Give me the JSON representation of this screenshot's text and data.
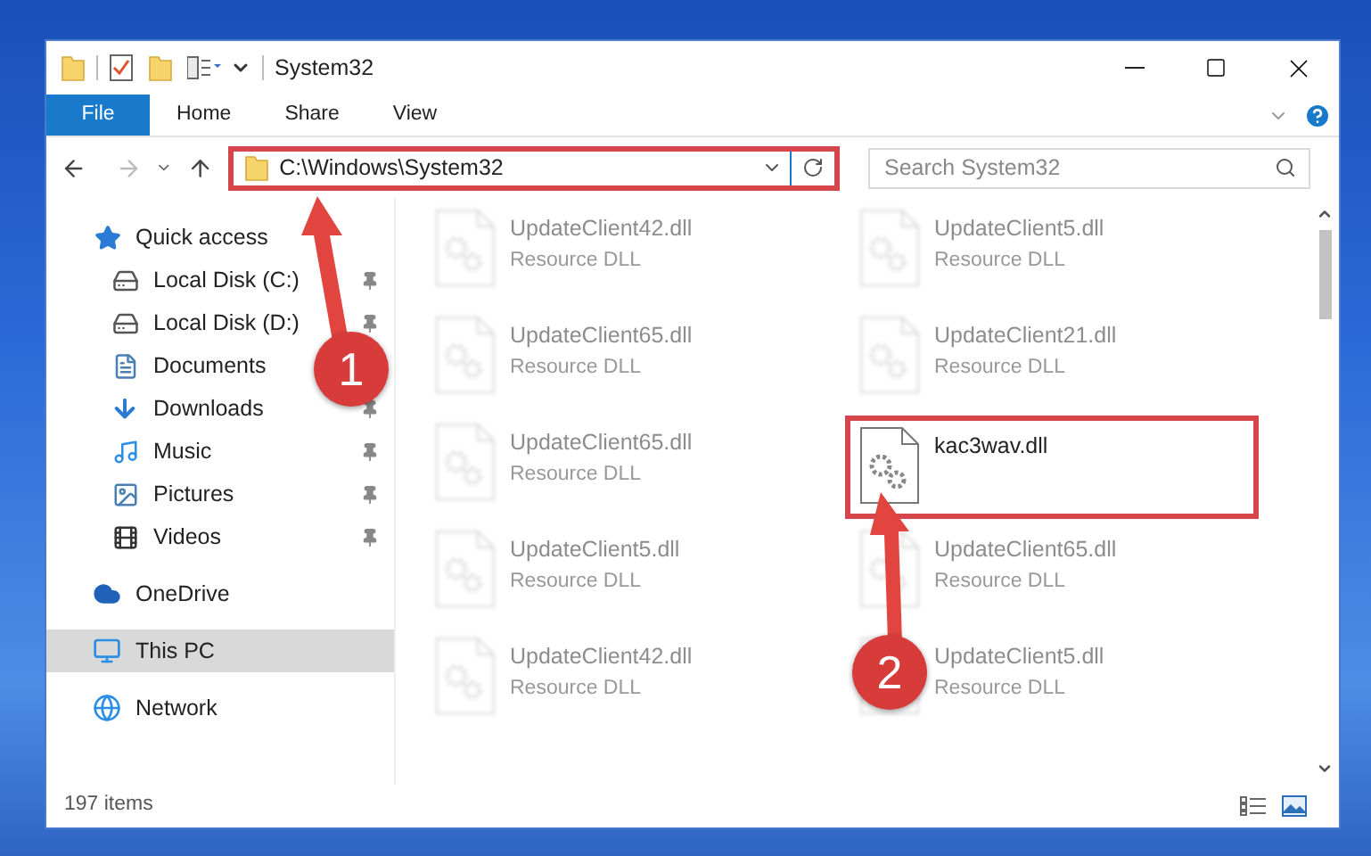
{
  "window": {
    "title": "System32"
  },
  "ribbon": {
    "tabs": [
      {
        "label": "File",
        "kind": "file",
        "selected": false
      },
      {
        "label": "Home",
        "kind": "tab",
        "selected": false
      },
      {
        "label": "Share",
        "kind": "tab",
        "selected": false
      },
      {
        "label": "View",
        "kind": "tab",
        "selected": false
      }
    ]
  },
  "address": {
    "path": "C:\\Windows\\System32",
    "highlighted": true
  },
  "search": {
    "placeholder": "Search System32"
  },
  "nav": [
    {
      "label": "Quick access",
      "kind": "quick",
      "selected": false,
      "children": [
        {
          "label": "Local Disk (C:)",
          "kind": "diskc",
          "pinned": true
        },
        {
          "label": "Local Disk (D:)",
          "kind": "disk",
          "pinned": true
        },
        {
          "label": "Documents",
          "kind": "documents"
        },
        {
          "label": "Downloads",
          "kind": "downloads",
          "pinned": true
        },
        {
          "label": "Music",
          "kind": "music",
          "pinned": true
        },
        {
          "label": "Pictures",
          "kind": "pictures",
          "pinned": true
        },
        {
          "label": "Videos",
          "kind": "videos",
          "pinned": true
        }
      ]
    },
    {
      "label": "OneDrive",
      "kind": "cloud",
      "selected": false
    },
    {
      "label": "This PC",
      "kind": "pc",
      "selected": true
    },
    {
      "label": "Network",
      "kind": "network",
      "selected": false
    }
  ],
  "files": [
    {
      "name": "UpdateClient42.dll",
      "type": "Resource DLL",
      "blurred": true,
      "highlighted": false
    },
    {
      "name": "UpdateClient5.dll",
      "type": "Resource DLL",
      "blurred": true,
      "highlighted": false
    },
    {
      "name": "UpdateClient65.dll",
      "type": "Resource DLL",
      "blurred": true,
      "highlighted": false
    },
    {
      "name": "UpdateClient21.dll",
      "type": "Resource DLL",
      "blurred": true,
      "highlighted": false
    },
    {
      "name": "UpdateClient65.dll",
      "type": "Resource DLL",
      "blurred": true,
      "highlighted": false
    },
    {
      "name": "kac3wav.dll",
      "blurred": false,
      "highlighted": true
    },
    {
      "name": "UpdateClient5.dll",
      "type": "Resource DLL",
      "blurred": true,
      "highlighted": false
    },
    {
      "name": "UpdateClient65.dll",
      "type": "Resource DLL",
      "blurred": true,
      "highlighted": false
    },
    {
      "name": "UpdateClient42.dll",
      "type": "Resource DLL",
      "blurred": true,
      "highlighted": false
    },
    {
      "name": "UpdateClient5.dll",
      "type": "Resource DLL",
      "blurred": true,
      "highlighted": false
    }
  ],
  "status_bar": {
    "count": "197 items"
  },
  "annotations": [
    {
      "label": "1"
    },
    {
      "label": "2"
    }
  ]
}
